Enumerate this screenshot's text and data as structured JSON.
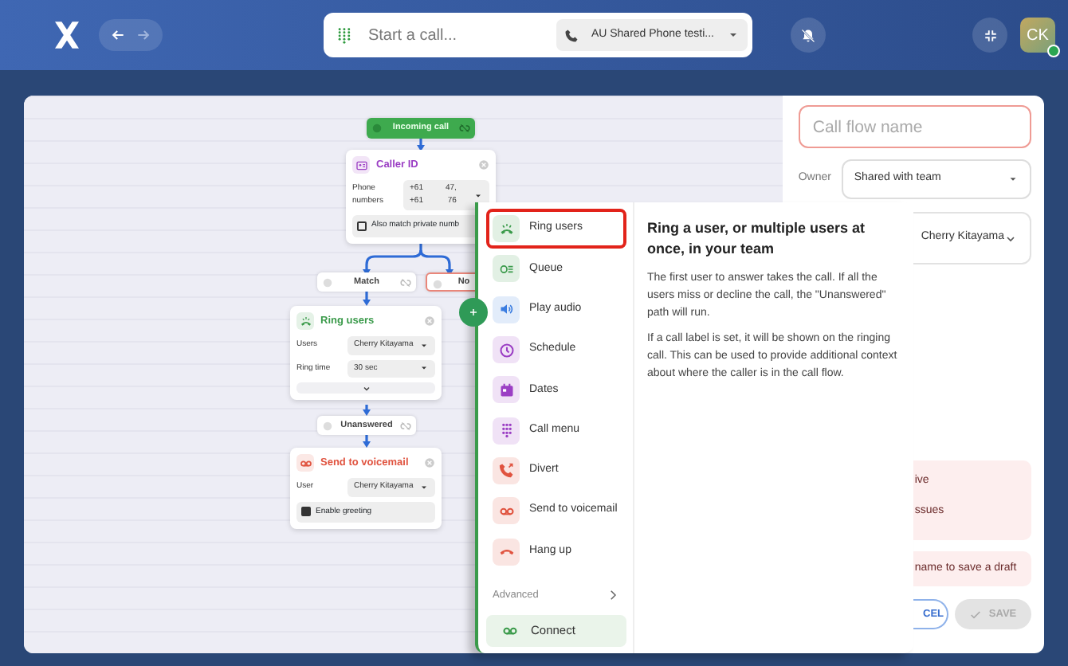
{
  "topbar": {
    "search": {
      "placeholder": "Start a call..."
    },
    "line_selector": "AU Shared Phone testi...",
    "avatar": {
      "initials": "CK"
    }
  },
  "canvas": {
    "nodes": [
      {
        "kind": "start",
        "label": "Incoming call"
      },
      {
        "kind": "card",
        "title": "Caller ID",
        "color": "#9b3fc4",
        "rows": [
          {
            "label": "Phone numbers",
            "values": [
              "+61",
              "+61"
            ],
            "tails": [
              "47,",
              "76"
            ]
          }
        ],
        "checkbox": {
          "label": "Also match private numb",
          "checked": false
        }
      },
      {
        "kind": "branch",
        "label": "Match"
      },
      {
        "kind": "error",
        "label": "No"
      },
      {
        "kind": "card",
        "title": "Ring users",
        "color": "#3a9a4a",
        "rows": [
          {
            "label": "Users",
            "values": [
              "Cherry Kitayama"
            ]
          },
          {
            "label": "Ring time",
            "values": [
              "30 sec"
            ]
          }
        ],
        "expandable": true
      },
      {
        "kind": "branch",
        "label": "Unanswered"
      },
      {
        "kind": "card",
        "title": "Send to voicemail",
        "color": "#e0533f",
        "rows": [
          {
            "label": "User",
            "values": [
              "Cherry Kitayama"
            ]
          }
        ],
        "checkbox": {
          "label": "Enable greeting",
          "checked": true
        }
      }
    ]
  },
  "menu": {
    "items": [
      {
        "label": "Ring users",
        "selected": true,
        "color": "#3a9a4a"
      },
      {
        "label": "Queue",
        "selected": false,
        "color": "#3a9a4a"
      },
      {
        "label": "Play audio",
        "selected": false,
        "color": "#3b7de0"
      },
      {
        "label": "Schedule",
        "selected": false,
        "color": "#9b3fc4"
      },
      {
        "label": "Dates",
        "selected": false,
        "color": "#9b3fc4"
      },
      {
        "label": "Call menu",
        "selected": false,
        "color": "#9b3fc4"
      },
      {
        "label": "Divert",
        "selected": false,
        "color": "#e0533f"
      },
      {
        "label": "Send to voicemail",
        "selected": false,
        "color": "#e0533f"
      },
      {
        "label": "Hang up",
        "selected": false,
        "color": "#e0533f"
      }
    ],
    "advanced": "Advanced",
    "connect": "Connect"
  },
  "detail": {
    "title": "Ring a user, or multiple users at once, in your team",
    "paragraphs": [
      "The first user to answer takes the call. If all the users miss or decline the call, the \"Unanswered\" path will run.",
      "If a call label is set, it will be shown on the ringing call. This can be used to provide additional context about where the caller is in the call flow."
    ]
  },
  "panel": {
    "name_field": {
      "placeholder": "Call flow name",
      "invalid": true
    },
    "owner_label": "Owner",
    "owner": "Shared with team",
    "assignee": "Cherry Kitayama",
    "errors": [
      [
        "ive",
        "ssues"
      ],
      [
        "name to save a draft"
      ]
    ],
    "cancel": "CEL",
    "save": {
      "label": "SAVE",
      "disabled": true
    }
  }
}
